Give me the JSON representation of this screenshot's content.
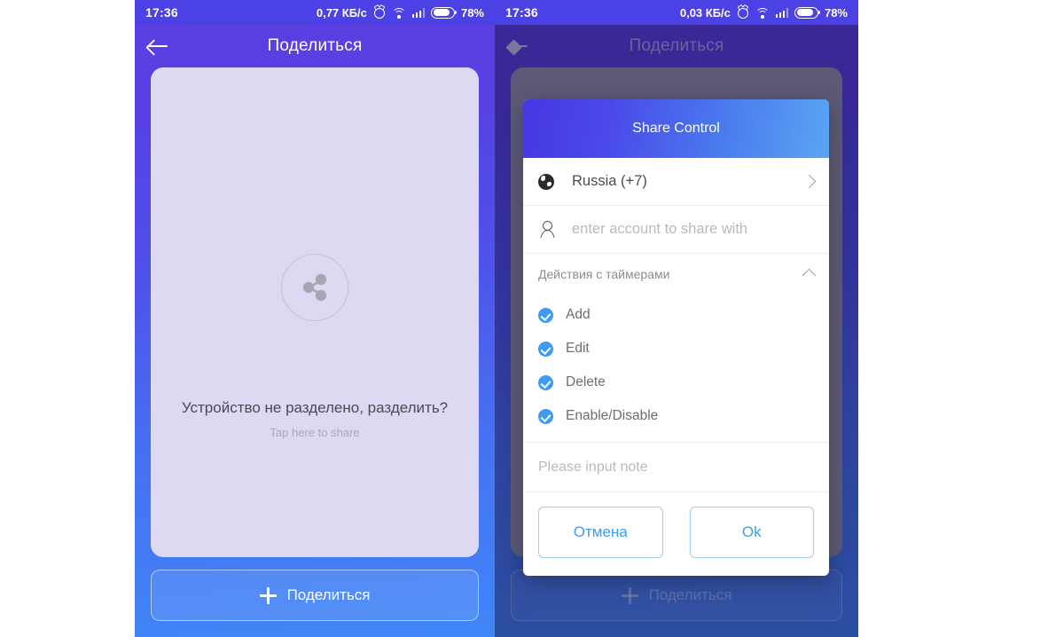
{
  "left_panel": {
    "statusbar": {
      "time": "17:36",
      "speed": "0,77 КБ/с",
      "battery_percent": "78%",
      "icons": [
        "alarm-icon",
        "wifi-icon",
        "signal-icon",
        "battery-icon"
      ]
    },
    "appbar": {
      "back_icon": "arrow-left-icon",
      "title": "Поделиться"
    },
    "empty_state": {
      "icon": "share-nodes-icon",
      "title": "Устройство не разделено, разделить?",
      "subtitle": "Tap here to share"
    },
    "share_button": {
      "icon": "plus-icon",
      "label": "Поделиться"
    }
  },
  "right_panel": {
    "statusbar": {
      "time": "17:36",
      "speed": "0,03 КБ/с",
      "battery_percent": "78%",
      "icons": [
        "alarm-icon",
        "wifi-icon",
        "signal-icon",
        "battery-icon"
      ]
    },
    "appbar": {
      "back_icon": "arrow-left-icon",
      "title": "Поделиться"
    },
    "share_button": {
      "icon": "plus-icon",
      "label": "Поделиться"
    }
  },
  "dialog": {
    "title": "Share Control",
    "country_row": {
      "icon": "globe-icon",
      "value": "Russia (+7)",
      "chevron": "chevron-right-icon"
    },
    "account_row": {
      "icon": "person-icon",
      "placeholder": "enter account to share with",
      "value": ""
    },
    "section": {
      "label": "Действия с таймерами",
      "collapse_icon": "chevron-up-icon",
      "expanded": true
    },
    "permissions": [
      {
        "label": "Add",
        "checked": true
      },
      {
        "label": "Edit",
        "checked": true
      },
      {
        "label": "Delete",
        "checked": true
      },
      {
        "label": "Enable/Disable",
        "checked": true
      }
    ],
    "note": {
      "placeholder": "Please input note",
      "value": ""
    },
    "cancel_label": "Отмена",
    "ok_label": "Ok"
  },
  "colors": {
    "bg_top": "#5b3fe0",
    "bg_bottom": "#3f86f7",
    "dialog_header_start": "#4737e2",
    "dialog_header_end": "#5aa5f2",
    "accent_blue": "#3d9bf0",
    "card_lavender": "#ddd9f3",
    "statusbar": "#4b41e4"
  }
}
